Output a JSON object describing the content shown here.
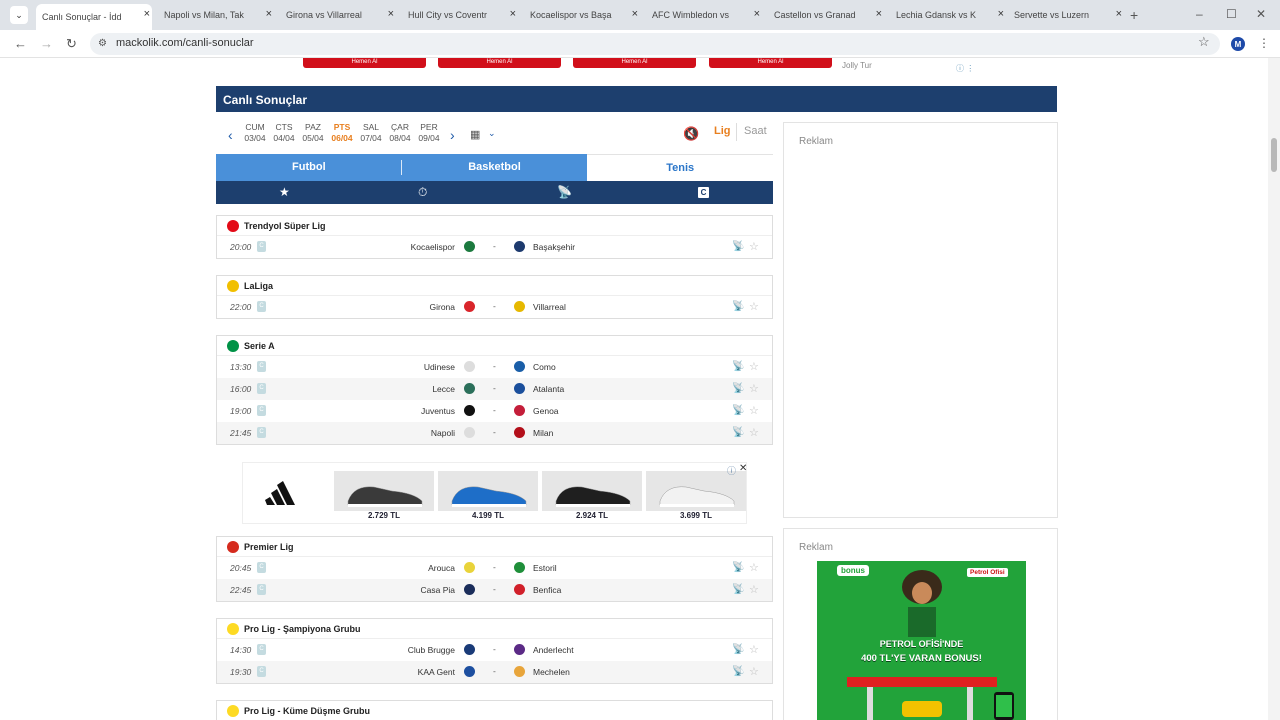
{
  "browser": {
    "tabs": [
      {
        "title": "Canlı Sonuçlar - İdd",
        "active": true
      },
      {
        "title": "Napoli vs Milan, Tak"
      },
      {
        "title": "Girona vs Villarreal"
      },
      {
        "title": "Hull City vs Coventr"
      },
      {
        "title": "Kocaelispor vs Başa"
      },
      {
        "title": "AFC Wimbledon vs"
      },
      {
        "title": "Castellon vs Granad"
      },
      {
        "title": "Lechia Gdansk vs K"
      },
      {
        "title": "Servette vs Luzern"
      }
    ],
    "favicon_letter": "m",
    "url": "mackolik.com/canli-sonuclar",
    "profile_initial": "M"
  },
  "top_ads": {
    "button_label": "Hemen Al",
    "sponsor": "Jolly Tur"
  },
  "page": {
    "title": "Canlı Sonuçlar"
  },
  "dates": [
    {
      "day": "CUM",
      "date": "03/04"
    },
    {
      "day": "CTS",
      "date": "04/04"
    },
    {
      "day": "PAZ",
      "date": "05/04"
    },
    {
      "day": "PTS",
      "date": "06/04",
      "active": true
    },
    {
      "day": "SAL",
      "date": "07/04"
    },
    {
      "day": "ÇAR",
      "date": "08/04"
    },
    {
      "day": "PER",
      "date": "09/04"
    }
  ],
  "view_toggle": {
    "lig": "Lig",
    "saat": "Saat"
  },
  "sport_tabs": [
    "Futbol",
    "Basketbol",
    "Tenis"
  ],
  "filter_icons": [
    "star-icon",
    "stopwatch-icon",
    "tv-icon",
    "c-badge-icon"
  ],
  "c_label": "C",
  "leagues": [
    {
      "name": "Trendyol Süper Lig",
      "flag_color": "#e30a17",
      "matches": [
        {
          "time": "20:00",
          "home": "Kocaelispor",
          "away": "Başakşehir",
          "home_color": "#1c7a3f",
          "away_color": "#1d3a6e"
        }
      ]
    },
    {
      "name": "LaLiga",
      "flag_color": "#f1bf00",
      "matches": [
        {
          "time": "22:00",
          "home": "Girona",
          "away": "Villarreal",
          "home_color": "#d9252b",
          "away_color": "#e6b800"
        }
      ]
    },
    {
      "name": "Serie A",
      "flag_color": "#009246",
      "matches": [
        {
          "time": "13:30",
          "home": "Udinese",
          "away": "Como",
          "home_color": "#dddddd",
          "away_color": "#1a5ea8"
        },
        {
          "time": "16:00",
          "home": "Lecce",
          "away": "Atalanta",
          "home_color": "#2b6f5a",
          "away_color": "#1b4f9c"
        },
        {
          "time": "19:00",
          "home": "Juventus",
          "away": "Genoa",
          "home_color": "#111111",
          "away_color": "#c41e3a"
        },
        {
          "time": "21:45",
          "home": "Napoli",
          "away": "Milan",
          "home_color": "#dddddd",
          "away_color": "#b30f1a"
        }
      ]
    },
    {
      "name": "Premier Lig",
      "flag_color": "#d52b1e",
      "matches": [
        {
          "time": "20:45",
          "home": "Arouca",
          "away": "Estoril",
          "home_color": "#e9d33a",
          "away_color": "#1f8f3a"
        },
        {
          "time": "22:45",
          "home": "Casa Pia",
          "away": "Benfica",
          "home_color": "#1b2d5a",
          "away_color": "#d1202a"
        }
      ]
    },
    {
      "name": "Pro Lig - Şampiyona Grubu",
      "flag_color": "#fdda24",
      "matches": [
        {
          "time": "14:30",
          "home": "Club Brugge",
          "away": "Anderlecht",
          "home_color": "#1a3b78",
          "away_color": "#5b2a86"
        },
        {
          "time": "19:30",
          "home": "KAA Gent",
          "away": "Mechelen",
          "home_color": "#1d4fa0",
          "away_color": "#e8a53b"
        }
      ]
    },
    {
      "name": "Pro Lig - Küme Düşme Grubu",
      "flag_color": "#fdda24",
      "matches": []
    }
  ],
  "ad_banner": {
    "brand_icon": "adidas-logo-icon",
    "prices": [
      "2.729 TL",
      "4.199 TL",
      "2.924 TL",
      "3.699 TL"
    ],
    "shoe_colors": [
      "#3a3a3a",
      "#1e6ec8",
      "#1f1f1f",
      "#f2f2f2"
    ]
  },
  "side_ads": {
    "label": "Reklam",
    "bonus_logo": "bonus",
    "bonus_brand": "Petrol Ofisi",
    "headline_1": "PETROL OFİSİ'NDE",
    "headline_2": "400 TL'YE VARAN BONUS!"
  },
  "colors": {
    "header_navy": "#1d3f6e",
    "tab_blue": "#4a90d9",
    "accent_orange": "#e87f1f"
  }
}
